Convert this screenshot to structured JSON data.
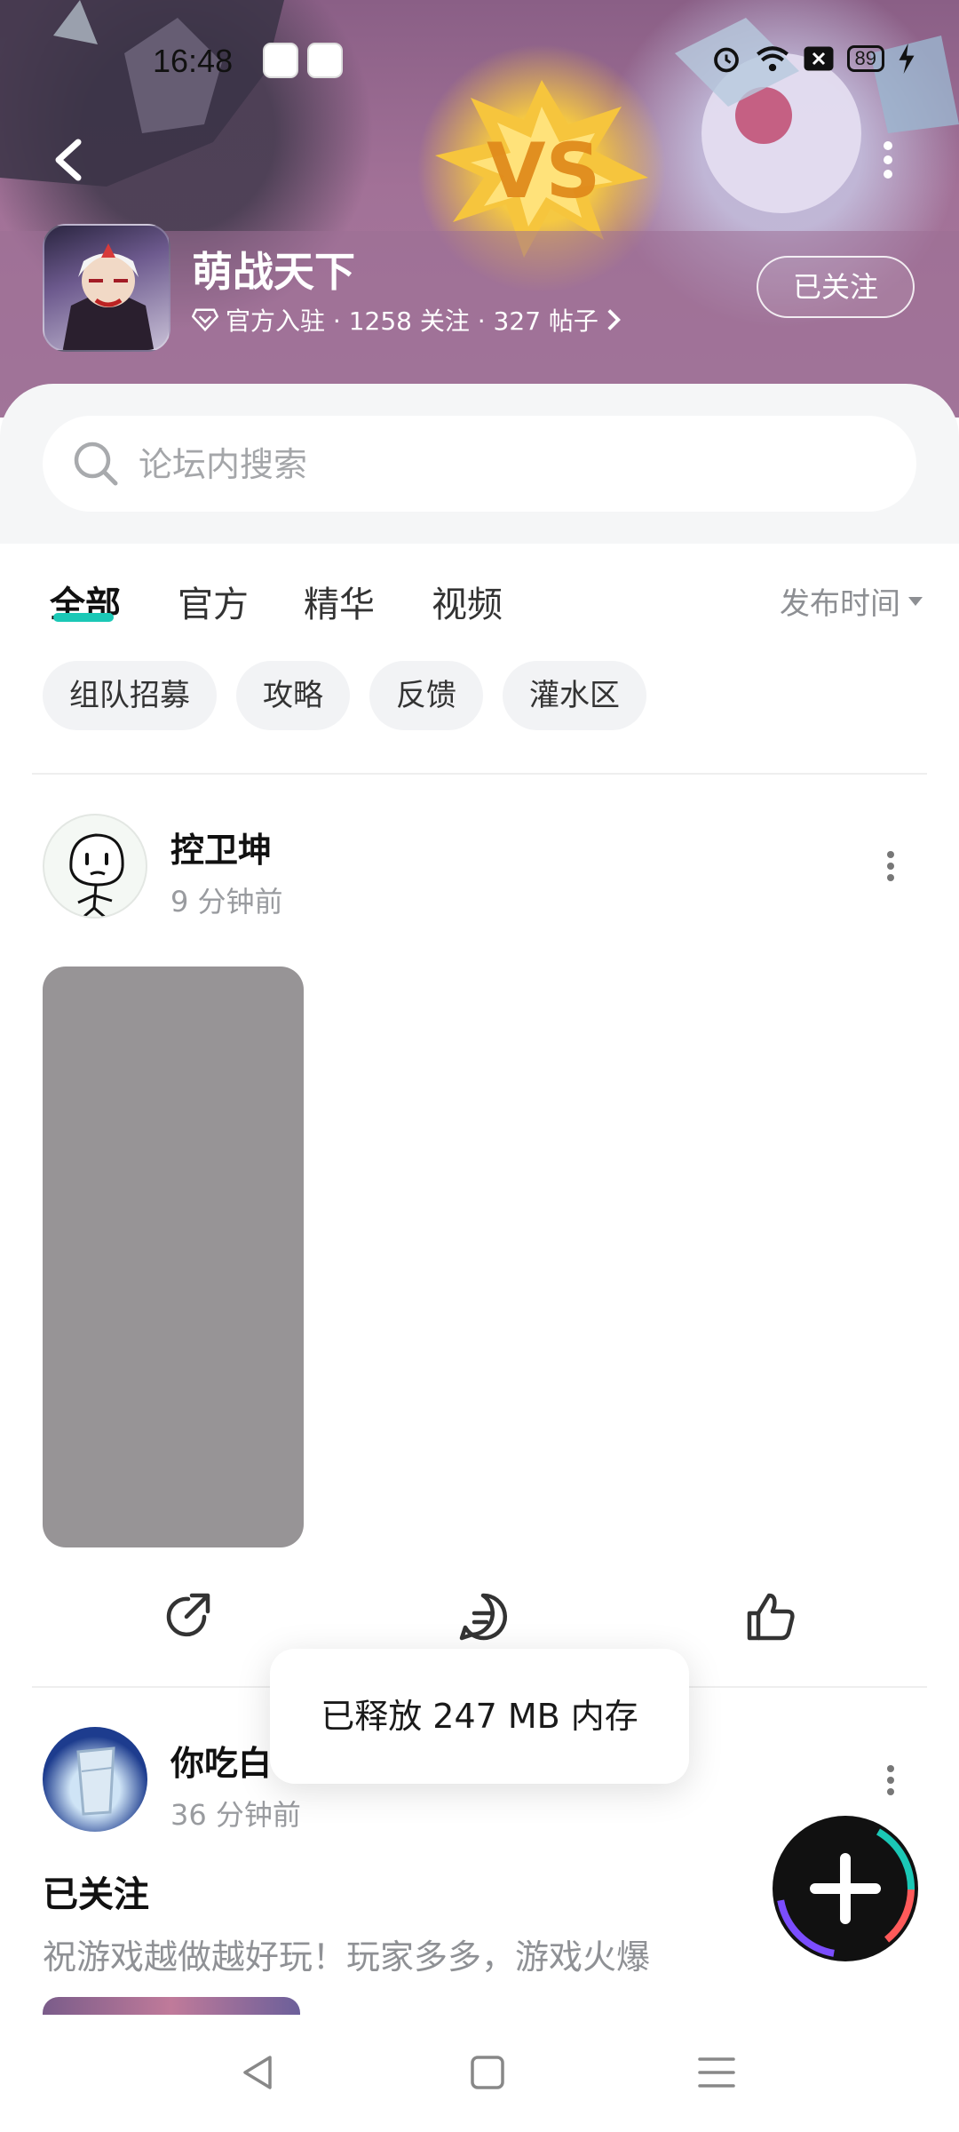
{
  "status_bar": {
    "time": "16:48",
    "battery": "89",
    "icons": [
      "alarm-icon",
      "wifi-icon",
      "sim-off-icon",
      "battery-icon",
      "charging-icon"
    ]
  },
  "header": {
    "forum_title": "萌战天下",
    "meta": "官方入驻 · 1258 关注 · 327 帖子",
    "follow_label": "已关注"
  },
  "search": {
    "placeholder": "论坛内搜索"
  },
  "tabs": {
    "items": [
      {
        "label": "全部",
        "active": true
      },
      {
        "label": "官方",
        "active": false
      },
      {
        "label": "精华",
        "active": false
      },
      {
        "label": "视频",
        "active": false
      }
    ],
    "sort_label": "发布时间"
  },
  "chips": [
    "组队招募",
    "攻略",
    "反馈",
    "灌水区"
  ],
  "posts": [
    {
      "author": "控卫坤",
      "time": "9 分钟前"
    },
    {
      "author": "你吃白",
      "time": "36 分钟前",
      "title": "已关注",
      "body": "祝游戏越做越好玩！玩家多多，游戏火爆"
    }
  ],
  "toast": {
    "message": "已释放 247 MB 内存"
  },
  "colors": {
    "accent": "#1bc8b6",
    "toast_bg": "#ffffff",
    "image_placeholder": "#979496",
    "fab_bg": "#111111"
  }
}
